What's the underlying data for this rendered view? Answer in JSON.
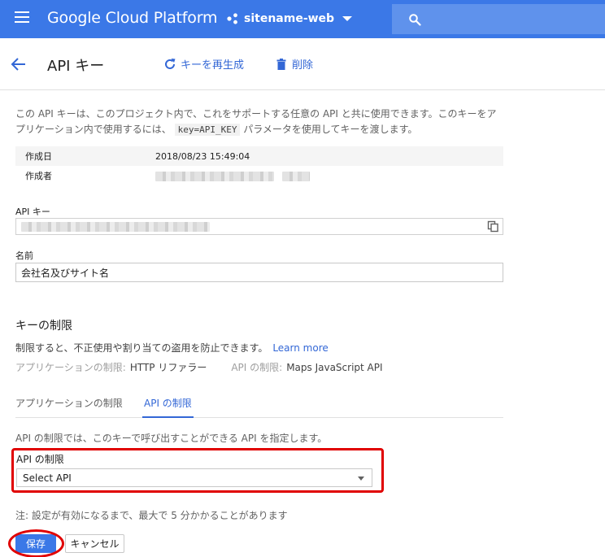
{
  "appbar": {
    "menu_icon": "hamburger-menu-icon",
    "brand": "Google Cloud Platform",
    "project_icon": "project-nodes-icon",
    "project_name": "sitename-web",
    "search_icon": "search-icon",
    "color": "#3b78e7"
  },
  "header": {
    "back_icon": "arrow-back-icon",
    "title": "API キー",
    "regenerate_label": "キーを再生成",
    "delete_label": "削除",
    "accent": "#3367d6"
  },
  "description": {
    "line1": "この API キーは、このプロジェクト内で、これをサポートする任意の API と共に使用できます。このキーをア",
    "line2_prefix": "プリケーション内で使用するには、",
    "code": "key=API_KEY",
    "line2_suffix": "パラメータを使用してキーを渡します。"
  },
  "meta": {
    "created_label": "作成日",
    "created_value": "2018/08/23 15:49:04",
    "creator_label": "作成者"
  },
  "api_key": {
    "label": "API キー",
    "copy_icon": "copy-icon"
  },
  "name_field": {
    "label": "名前",
    "value": "会社名及びサイト名"
  },
  "restrictions": {
    "title": "キーの制限",
    "desc": "制限すると、不正使用や割り当ての盗用を防止できます。",
    "learn_more": "Learn more",
    "app_label": "アプリケーションの制限:",
    "app_value": "HTTP リファラー",
    "api_label": "API の制限:",
    "api_value": "Maps JavaScript API"
  },
  "tabs": [
    {
      "label": "アプリケーションの制限",
      "active": false
    },
    {
      "label": "API の制限",
      "active": true
    }
  ],
  "api_restriction": {
    "desc": "API の制限では、このキーで呼び出すことができる API を指定します。",
    "label": "API の制限",
    "select_value": "Select API"
  },
  "note": "注: 設定が有効になるまで、最大で 5 分かかることがあります",
  "buttons": {
    "save": "保存",
    "cancel": "キャンセル"
  },
  "annotation_color": "#e00000"
}
